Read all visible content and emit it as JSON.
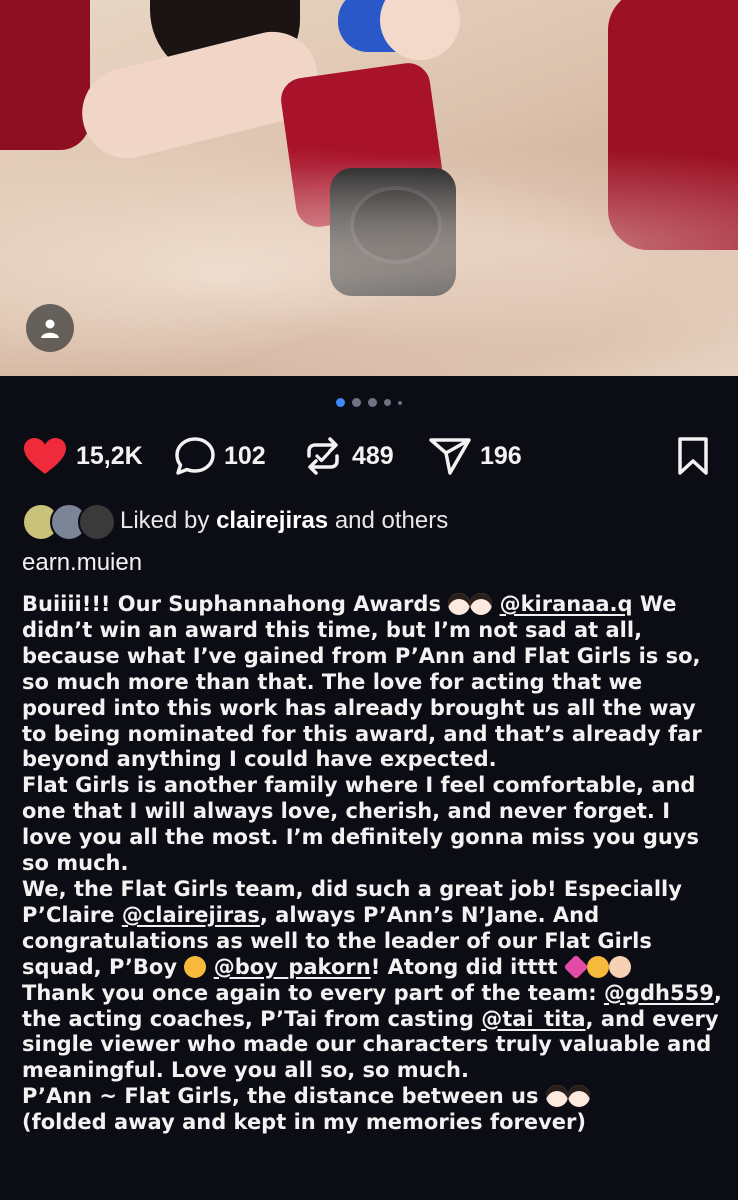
{
  "post": {
    "photo_alt": "Photo",
    "carousel": {
      "total": 5,
      "active": 0
    }
  },
  "actions": {
    "likes": "15,2K",
    "comments": "102",
    "reposts": "489",
    "shares": "196",
    "like_color": "#ee2a3b"
  },
  "liked_by": {
    "prefix": "Liked by",
    "user": "clairejiras",
    "suffix": "and others"
  },
  "author": {
    "username": "earn.muien"
  },
  "caption": {
    "p1_a": "Buiiii!!! Our Suphannahong Awards",
    "m_kiranaa": "@kiranaa.q",
    "p1_b": "We didn’t win an award this time, but I’m not sad at all, because what I’ve gained from P’Ann and Flat Girls is so, so much more than that. The love for acting that we poured into this work has already brought us all the way to being nominated for this award, and that’s already far beyond anything I could have expected.",
    "p2": "Flat Girls is another family where I feel comfortable, and one that I will always love, cherish, and never forget. I love you all the most. I’m definitely gonna miss you guys so much.",
    "p3_a": "We, the Flat Girls team, did such a great job! Especially P’Claire",
    "m_claire": "@clairejiras",
    "p3_b": ", always P’Ann’s N’Jane. And congratulations as well to the leader of our Flat Girls squad, P’Boy",
    "m_boy": "@boy_pakorn",
    "p3_c": "! Atong did itttt",
    "p4_a": "Thank you once again to every part of the team:",
    "m_gdh": "@gdh559",
    "p4_b": ", the acting coaches, P’Tai from casting",
    "m_tai": "@tai_tita",
    "p4_c": ", and every single viewer who made our characters truly valuable and meaningful. Love you all so, so much.",
    "p5_a": "P’Ann ~ Flat Girls, the distance between us",
    "p5_b": "(folded away and kept in my memories forever)"
  }
}
